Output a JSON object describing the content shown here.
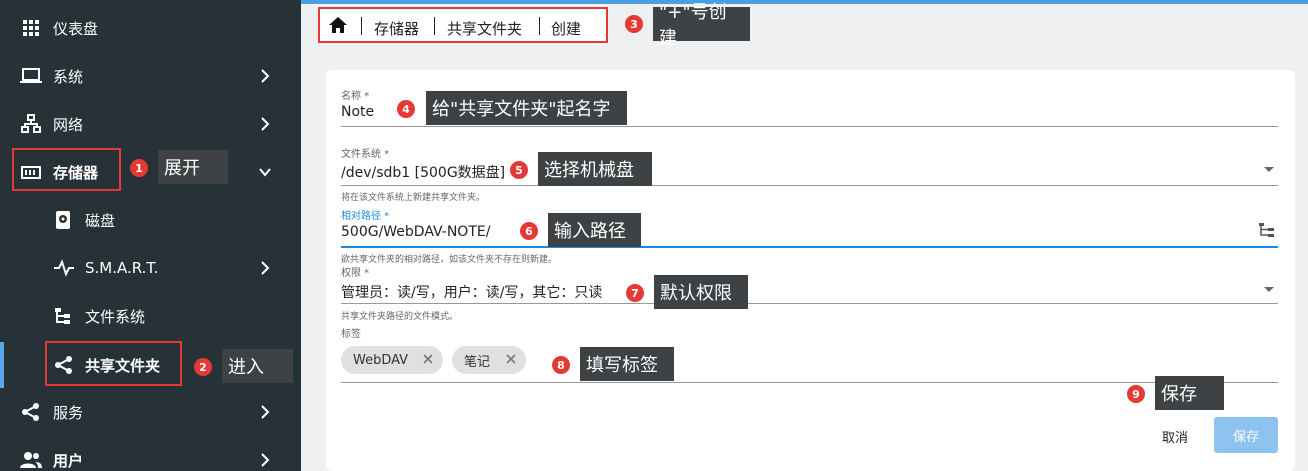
{
  "sidebar": {
    "items": [
      {
        "label": "仪表盘",
        "icon": "grid-icon"
      },
      {
        "label": "系统",
        "icon": "laptop-icon"
      },
      {
        "label": "网络",
        "icon": "network-icon"
      },
      {
        "label": "存储器",
        "icon": "storage-icon"
      },
      {
        "label": "磁盘",
        "icon": "disk-icon"
      },
      {
        "label": "S.M.A.R.T.",
        "icon": "pulse-icon"
      },
      {
        "label": "文件系统",
        "icon": "tree-icon"
      },
      {
        "label": "共享文件夹",
        "icon": "share-icon"
      },
      {
        "label": "服务",
        "icon": "share-icon"
      },
      {
        "label": "用户",
        "icon": "users-icon"
      }
    ]
  },
  "breadcrumb": {
    "items": [
      "存储器",
      "共享文件夹",
      "创建"
    ]
  },
  "form": {
    "name_label": "名称 *",
    "name_value": "Note",
    "fs_label": "文件系统 *",
    "fs_value": "/dev/sdb1 [500G数据盘]",
    "fs_hint": "将在该文件系统上新建共享文件夹。",
    "path_label": "相对路径 *",
    "path_value": "500G/WebDAV-NOTE/",
    "path_hint": "欲共享文件夹的相对路径，如该文件夹不存在则新建。",
    "perm_label": "权限 *",
    "perm_value": "管理员：读/写，用户：读/写，其它：只读",
    "perm_hint": "共享文件夹路径的文件模式。",
    "tags_label": "标签",
    "tags": [
      "WebDAV",
      "笔记"
    ],
    "cancel_label": "取消",
    "save_label": "保存"
  },
  "annotations": [
    {
      "num": "1",
      "text": "展开"
    },
    {
      "num": "2",
      "text": "进入"
    },
    {
      "num": "3",
      "text": "\"+\"号创建"
    },
    {
      "num": "4",
      "text": "给\"共享文件夹\"起名字"
    },
    {
      "num": "5",
      "text": "选择机械盘"
    },
    {
      "num": "6",
      "text": "输入路径"
    },
    {
      "num": "7",
      "text": "默认权限"
    },
    {
      "num": "8",
      "text": "填写标签"
    },
    {
      "num": "9",
      "text": "保存"
    }
  ],
  "colors": {
    "sidebar_bg": "#263238",
    "accent": "#1e88e5",
    "annotation_red": "#e53935",
    "save_button": "#8ec3ef"
  }
}
